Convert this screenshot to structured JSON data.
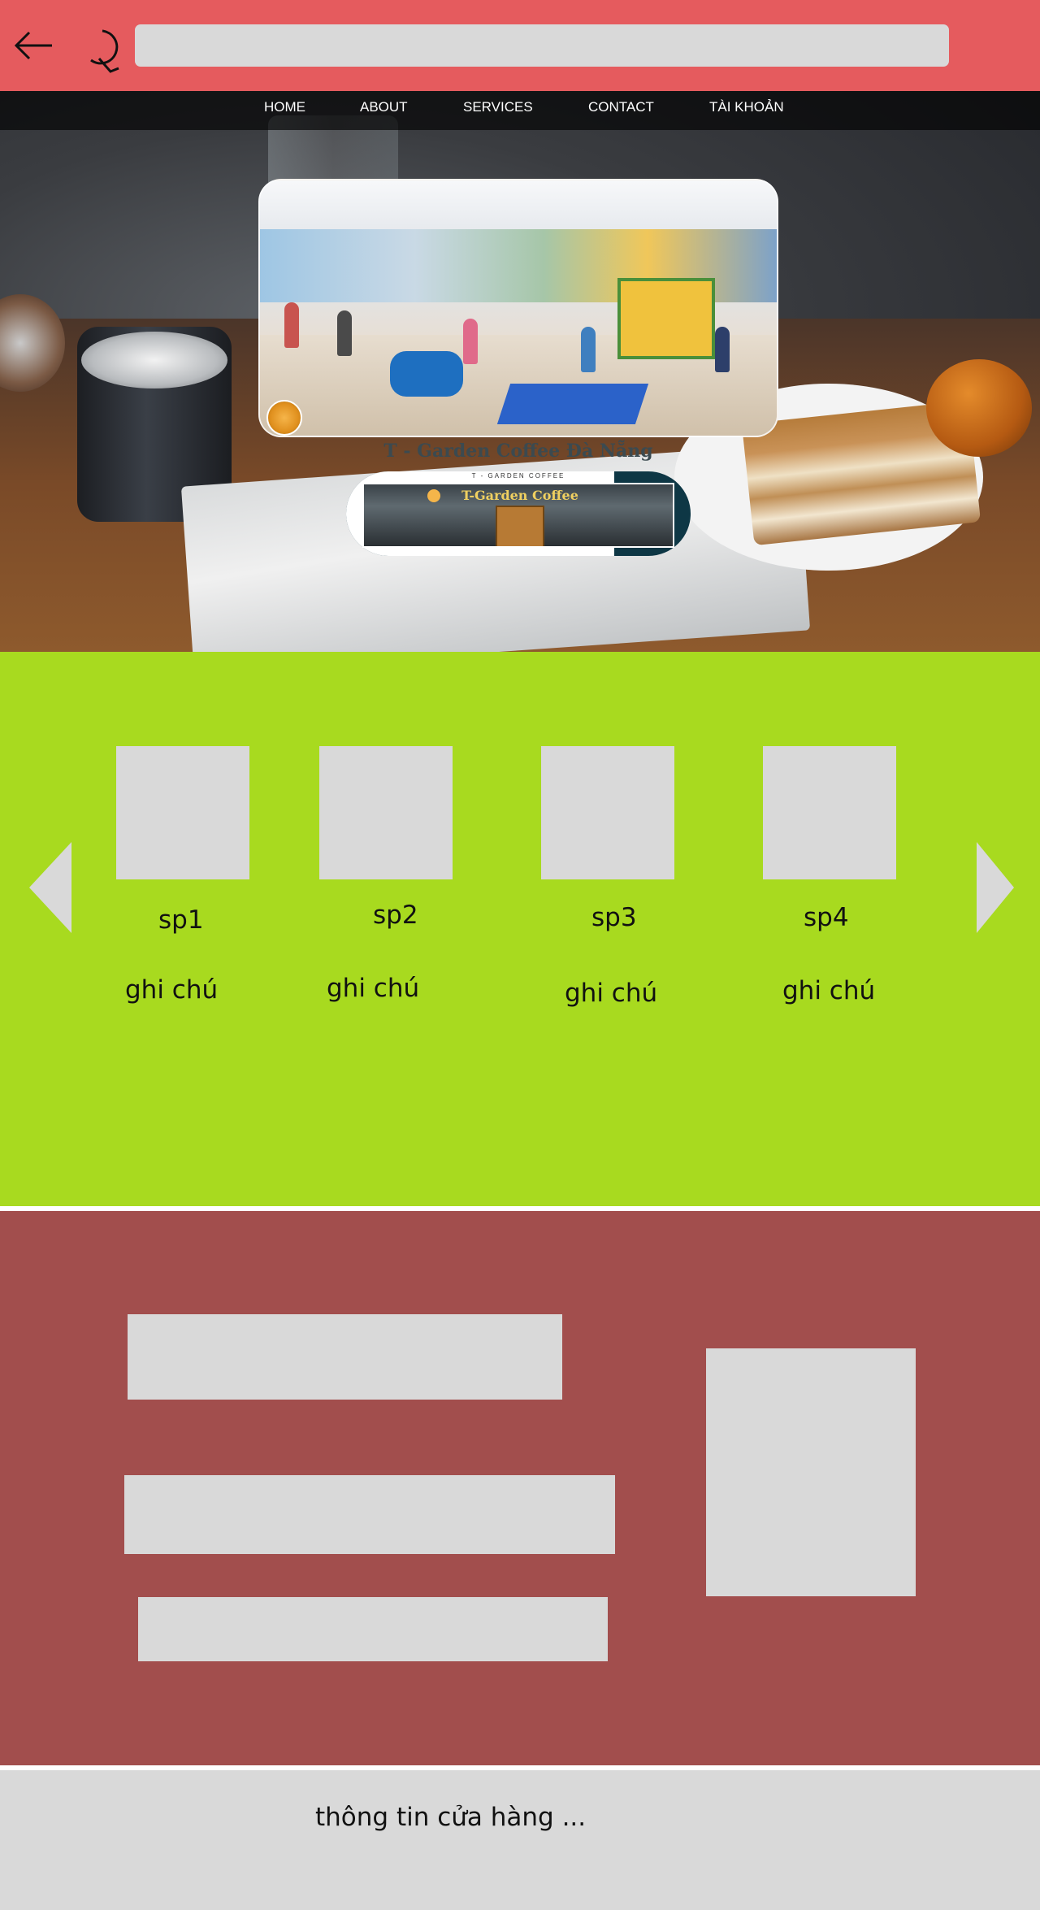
{
  "topbar": {
    "back_icon": "arrow-left-icon",
    "reload_icon": "reload-icon",
    "address_value": "",
    "colors": {
      "bar": "#e55b5e",
      "field": "#d9d9d9"
    }
  },
  "nav": {
    "items": [
      {
        "label": "HOME"
      },
      {
        "label": "ABOUT"
      },
      {
        "label": "SERVICES"
      },
      {
        "label": "CONTACT"
      },
      {
        "label": "TÀI KHOẢN"
      }
    ]
  },
  "hero": {
    "card_title": "T - Garden Coffee Đà Nẵng",
    "banner_caption": "T - GARDEN COFFEE",
    "banner_sign": "T-Garden Coffee"
  },
  "products": {
    "background": "#a8da1f",
    "prev_icon": "triangle-left-icon",
    "next_icon": "triangle-right-icon",
    "items": [
      {
        "name": "sp1",
        "note": "ghi chú"
      },
      {
        "name": "sp2",
        "note": "ghi chú"
      },
      {
        "name": "sp3",
        "note": "ghi chú"
      },
      {
        "name": "sp4",
        "note": "ghi chú"
      }
    ]
  },
  "info": {
    "background": "#a24e4d"
  },
  "footer": {
    "text": "thông tin cửa hàng ..."
  }
}
